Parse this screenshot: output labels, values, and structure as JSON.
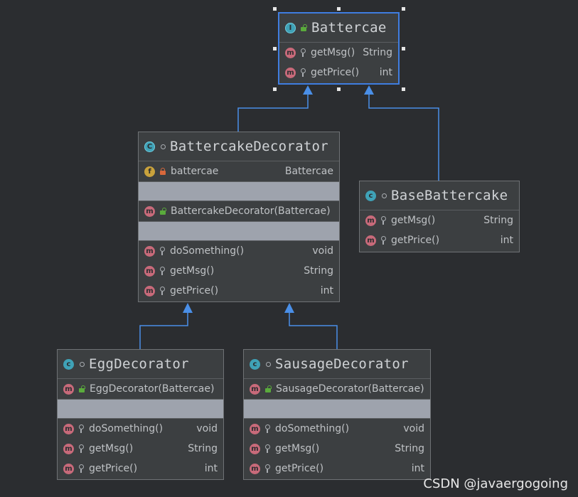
{
  "diagram": {
    "classes": {
      "battercae": {
        "name": "Battercae",
        "kind": "interface",
        "methods": [
          {
            "name": "getMsg()",
            "type": "String"
          },
          {
            "name": "getPrice()",
            "type": "int"
          }
        ]
      },
      "battercake_decorator": {
        "name": "BattercakeDecorator",
        "kind": "abstract-class",
        "fields": [
          {
            "name": "battercae",
            "type": "Battercae"
          }
        ],
        "constructors": [
          {
            "name": "BattercakeDecorator(Battercae)"
          }
        ],
        "methods": [
          {
            "name": "doSomething()",
            "type": "void"
          },
          {
            "name": "getMsg()",
            "type": "String"
          },
          {
            "name": "getPrice()",
            "type": "int"
          }
        ]
      },
      "base_battercake": {
        "name": "BaseBattercake",
        "kind": "class",
        "methods": [
          {
            "name": "getMsg()",
            "type": "String"
          },
          {
            "name": "getPrice()",
            "type": "int"
          }
        ]
      },
      "egg_decorator": {
        "name": "EggDecorator",
        "kind": "class",
        "constructors": [
          {
            "name": "EggDecorator(Battercae)"
          }
        ],
        "methods": [
          {
            "name": "doSomething()",
            "type": "void"
          },
          {
            "name": "getMsg()",
            "type": "String"
          },
          {
            "name": "getPrice()",
            "type": "int"
          }
        ]
      },
      "sausage_decorator": {
        "name": "SausageDecorator",
        "kind": "class",
        "constructors": [
          {
            "name": "SausageDecorator(Battercae)"
          }
        ],
        "methods": [
          {
            "name": "doSomething()",
            "type": "void"
          },
          {
            "name": "getMsg()",
            "type": "String"
          },
          {
            "name": "getPrice()",
            "type": "int"
          }
        ]
      }
    },
    "relations": [
      {
        "from": "BattercakeDecorator",
        "to": "Battercae",
        "type": "implements"
      },
      {
        "from": "BaseBattercake",
        "to": "Battercae",
        "type": "implements"
      },
      {
        "from": "EggDecorator",
        "to": "BattercakeDecorator",
        "type": "extends"
      },
      {
        "from": "SausageDecorator",
        "to": "BattercakeDecorator",
        "type": "extends"
      }
    ],
    "colors": {
      "background": "#2b2d30",
      "box": "#3c3f41",
      "selection": "#3f7de0",
      "arrow": "#4a8fe7",
      "empty_section": "#9ea3ad"
    }
  },
  "watermark": "CSDN @javaergogoing"
}
